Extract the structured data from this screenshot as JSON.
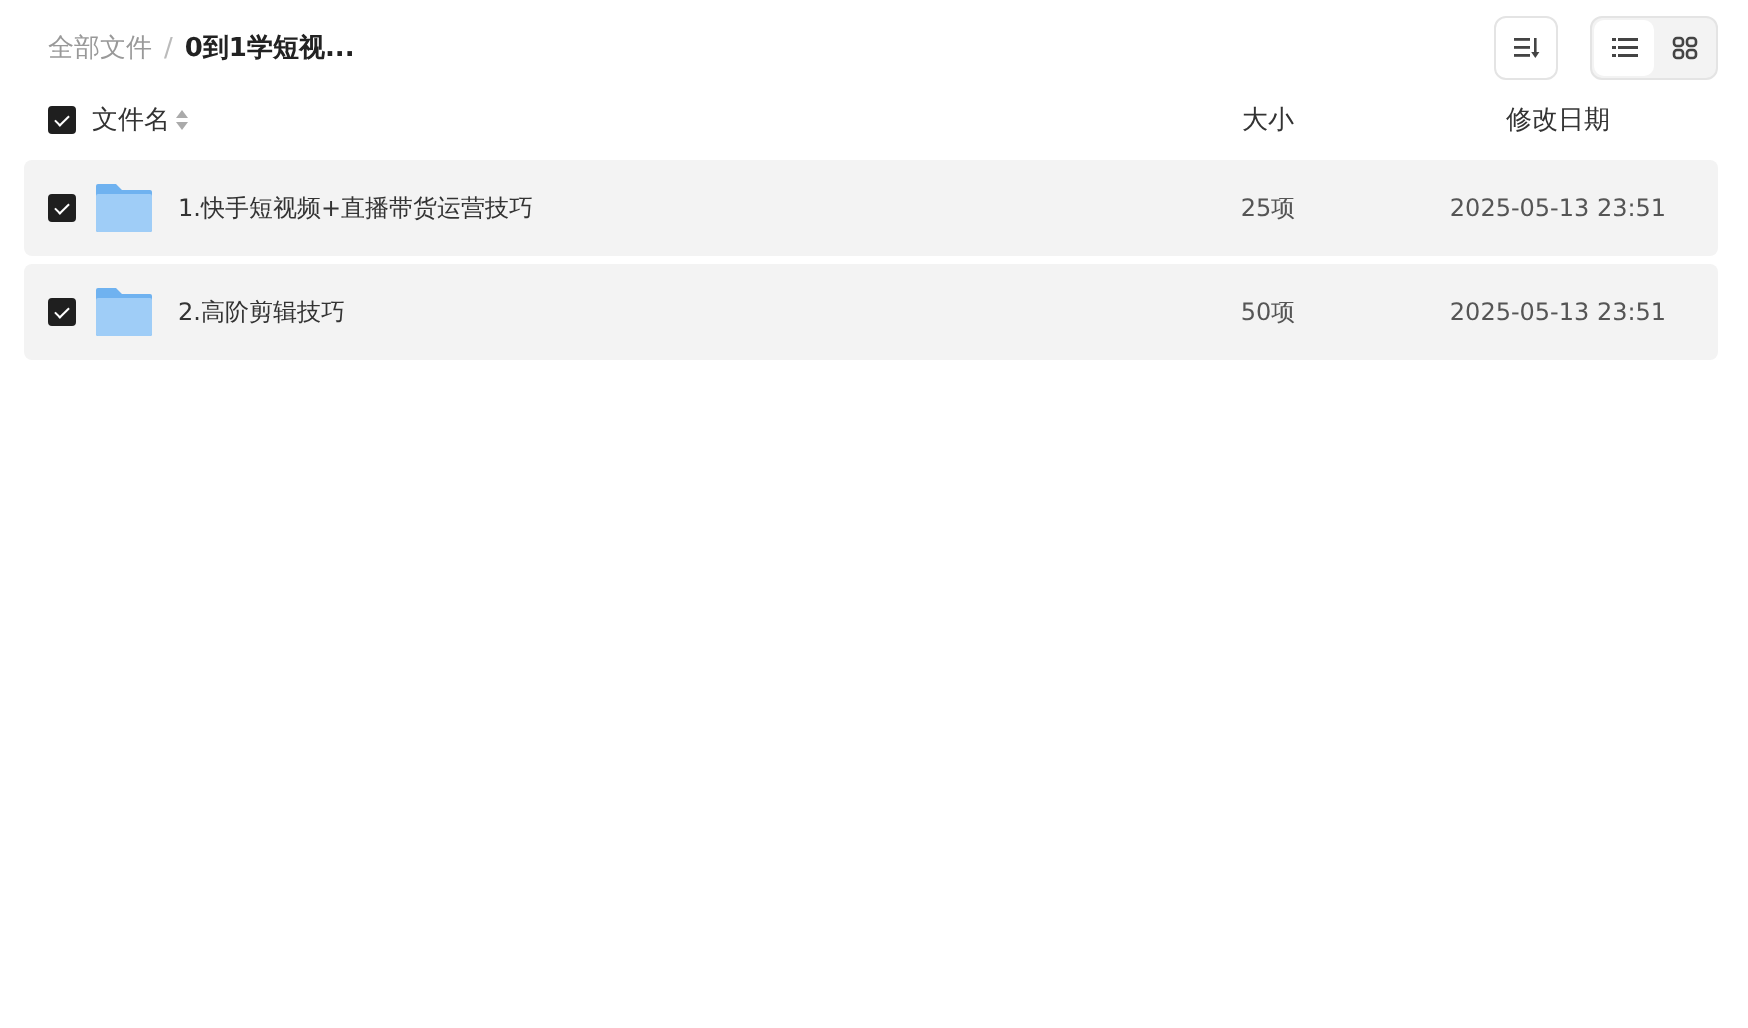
{
  "breadcrumb": [
    {
      "label": "全部文件",
      "current": false
    },
    {
      "label": "0到1学短视...",
      "current": true
    }
  ],
  "breadcrumb_separator": "/",
  "view_modes": [
    {
      "kind": "list",
      "selected": true
    },
    {
      "kind": "grid",
      "selected": false
    }
  ],
  "table": {
    "select_all_checked": true,
    "columns": [
      "文件名",
      "大小",
      "修改日期"
    ],
    "rows": [
      {
        "checked": true,
        "name": "1.快手短视频+直播带货运营技巧",
        "size": "25项",
        "modified": "2025-05-13 23:51"
      },
      {
        "checked": true,
        "name": "2.高阶剪辑技巧",
        "size": "50项",
        "modified": "2025-05-13 23:51"
      }
    ]
  }
}
